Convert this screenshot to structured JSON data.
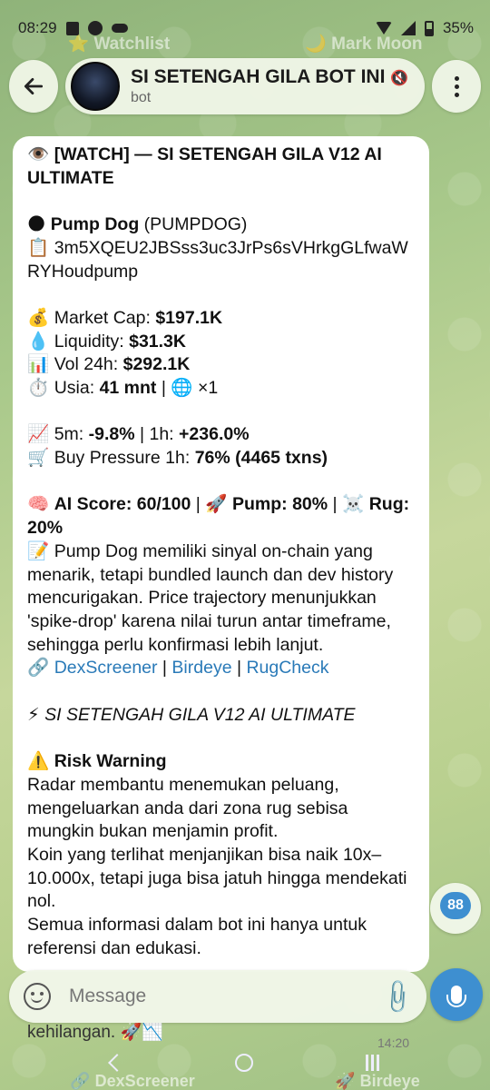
{
  "status_bar": {
    "time": "08:29",
    "battery": "35%"
  },
  "pinned_ghost": {
    "left": "⭐ Watchlist",
    "right": "🌙 Mark Moon"
  },
  "header": {
    "title": "SI SETENGAH GILA BOT INI",
    "subtitle": "bot",
    "mute_icon": "🔇"
  },
  "message": {
    "watch_line": "[WATCH] — SI SETENGAH GILA V12 AI ULTIMATE",
    "token_name": "Pump Dog",
    "token_symbol": " (PUMPDOG)",
    "contract": "3m5XQEU2JBSss3uc3JrPs6sVHrkgGLfwaWRYHoudpump",
    "market_cap_label": "Market Cap: ",
    "market_cap": "$197.1K",
    "liquidity_label": "Liquidity: ",
    "liquidity": "$31.3K",
    "vol_label": "Vol 24h: ",
    "vol": "$292.1K",
    "age_label": "Usia: ",
    "age": "41 mnt",
    "age_sep": " | ",
    "age_mult": " ×1",
    "change_5m_label": "5m: ",
    "change_5m": "-9.8%",
    "change_sep": " | 1h: ",
    "change_1h": "+236.0%",
    "buy_pressure_label": "Buy Pressure 1h: ",
    "buy_pressure": "76% (4465 txns)",
    "ai_score": "AI Score: 60/100",
    "pump": "Pump: 80%",
    "rug": "Rug: 20%",
    "analysis": "Pump Dog memiliki sinyal on-chain yang menarik, tetapi bundled launch dan dev history mencurigakan. Price trajectory menunjukkan 'spike-drop' karena nilai turun antar timeframe, sehingga perlu konfirmasi lebih lanjut.",
    "link_dex": "DexScreener",
    "link_birdeye": "Birdeye",
    "link_rug": "RugCheck",
    "signature": "SI SETENGAH GILA V12 AI ULTIMATE",
    "risk_title": "Risk Warning",
    "risk_1": "Radar membantu menemukan peluang, mengeluarkan anda dari zona rug sebisa mungkin bukan menjamin profit.",
    "risk_2": "Koin yang terlihat menjanjikan bisa naik 10x–10.000x, tetapi juga bisa jatuh hingga mendekati nol.",
    "risk_3": "Semua informasi dalam bot ini hanya untuk referensi dan edukasi.",
    "tail": "kehilangan. 🚀📉",
    "time": "14:20"
  },
  "scroll": {
    "unread_count": "88"
  },
  "composer": {
    "placeholder": "Message"
  },
  "ghost_links": {
    "left": "🔗 DexScreener",
    "right": "🚀 Birdeye"
  }
}
